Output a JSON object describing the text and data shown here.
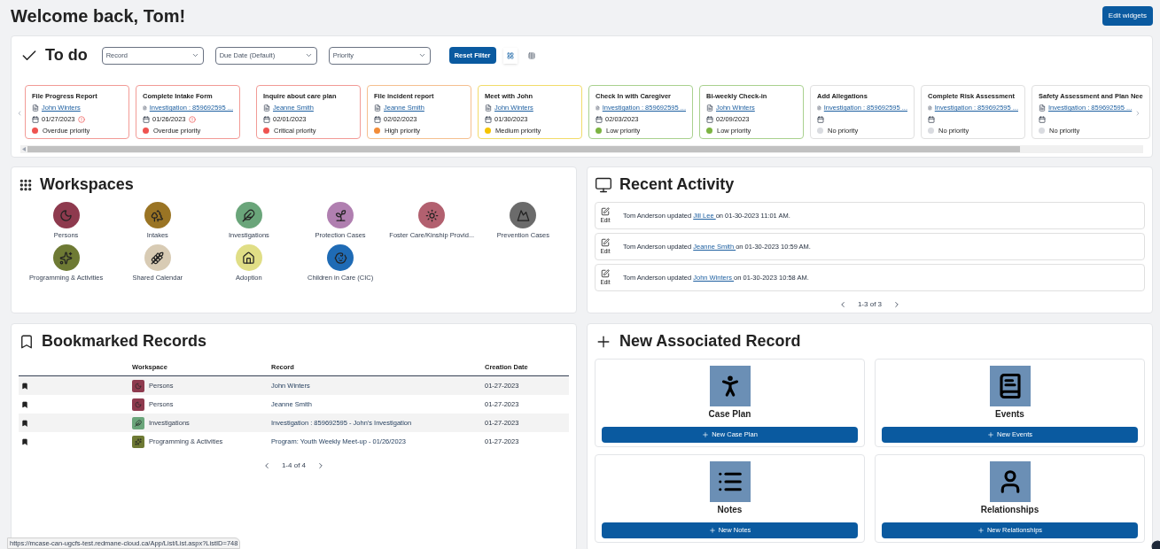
{
  "page": {
    "title": "Welcome back, Tom!",
    "edit_button": "Edit widgets"
  },
  "todo": {
    "title": "To do",
    "filters": [
      {
        "value": "Record"
      },
      {
        "value": "Due Date (Default)"
      },
      {
        "value": "Priority"
      }
    ],
    "reset_button": "Reset Filter",
    "views": [
      {
        "kind": "grid",
        "selected": true
      },
      {
        "kind": "list",
        "selected": false
      }
    ],
    "items": [
      {
        "title": "File Progress Report",
        "record": "John Winters",
        "date": "01/27/2023",
        "overdue": true,
        "kind": "overdue",
        "priority_label": "Overdue priority"
      },
      {
        "title": "Complete Intake Form",
        "record": "Investigation : 859692595 ...",
        "date": "01/26/2023",
        "overdue": true,
        "kind": "overdue",
        "priority_label": "Overdue priority"
      },
      {
        "title": "Inquire about care plan",
        "record": "Jeanne Smith",
        "date": "02/01/2023",
        "overdue": false,
        "kind": "critical",
        "priority_label": "Critical priority"
      },
      {
        "title": "File incident report",
        "record": "Jeanne Smith",
        "date": "02/02/2023",
        "overdue": false,
        "kind": "high",
        "priority_label": "High priority"
      },
      {
        "title": "Meet with John",
        "record": "John Winters",
        "date": "01/30/2023",
        "overdue": false,
        "kind": "medium",
        "priority_label": "Medium priority"
      },
      {
        "title": "Check In with Caregiver",
        "record": "Investigation : 859692595 ...",
        "date": "02/03/2023",
        "overdue": false,
        "kind": "low",
        "priority_label": "Low priority"
      },
      {
        "title": "Bi-weekly Check-in",
        "record": "John Winters",
        "date": "02/09/2023",
        "overdue": false,
        "kind": "low",
        "priority_label": "Low priority"
      },
      {
        "title": "Add Allegations",
        "record": "Investigation : 859692595 ...",
        "overdue": false,
        "kind": "none",
        "priority_label": "No priority"
      },
      {
        "title": "Complete Risk Assessment",
        "record": "Investigation : 859692595 ...",
        "overdue": false,
        "kind": "none",
        "priority_label": "No priority"
      },
      {
        "title": "Safety Assessment and Plan Nee",
        "record": "Investigation : 859692595 ...",
        "overdue": false,
        "kind": "none",
        "priority_label": "No priority"
      }
    ]
  },
  "workspaces": {
    "title": "Workspaces",
    "items": [
      {
        "label": "Persons",
        "kind": "moon",
        "color": "#8e3a4e"
      },
      {
        "label": "Intakes",
        "kind": "trees",
        "color": "#9a7424"
      },
      {
        "label": "Investigations",
        "kind": "feather",
        "color": "#6aa57a"
      },
      {
        "label": "Protection Cases",
        "kind": "sprout",
        "color": "#b07fb0"
      },
      {
        "label": "Foster Care/Kinship Provid...",
        "kind": "sun",
        "color": "#b2606f"
      },
      {
        "label": "Prevention Cases",
        "kind": "mountain",
        "color": "#6b6b6b"
      },
      {
        "label": "Programming & Activities",
        "kind": "stars",
        "color": "#6e7a34"
      },
      {
        "label": "Shared Calendar",
        "kind": "wheat",
        "color": "#d8cbb4"
      },
      {
        "label": "Adoption",
        "kind": "home",
        "color": "#e0de86"
      },
      {
        "label": "Children in Care (CIC)",
        "kind": "child",
        "color": "#1f6bb5"
      }
    ]
  },
  "recent_activity": {
    "title": "Recent Activity",
    "items": [
      {
        "action": "Edit",
        "before": "Tom Anderson updated ",
        "link": "Jill Lee ",
        "after": " on 01-30-2023 11:01 AM."
      },
      {
        "action": "Edit",
        "before": "Tom Anderson updated ",
        "link": "Jeanne Smith ",
        "after": " on 01-30-2023 10:59 AM."
      },
      {
        "action": "Edit",
        "before": "Tom Anderson updated ",
        "link": "John Winters ",
        "after": " on 01-30-2023 10:58 AM."
      }
    ],
    "pager": "1-3 of 3"
  },
  "bookmarks": {
    "title": "Bookmarked Records",
    "columns": [
      "Workspace",
      "Record",
      "Creation Date"
    ],
    "rows": [
      {
        "workspace": "Persons",
        "kind": "moon",
        "color": "#8e3a4e",
        "record": "John Winters",
        "date": "01-27-2023"
      },
      {
        "workspace": "Persons",
        "kind": "moon",
        "color": "#8e3a4e",
        "record": "Jeanne Smith",
        "date": "01-27-2023"
      },
      {
        "workspace": "Investigations",
        "kind": "feather",
        "color": "#6aa57a",
        "record": "Investigation : 859692595 - John's Investigation",
        "date": "01-27-2023"
      },
      {
        "workspace": "Programming & Activities",
        "kind": "stars",
        "color": "#6e7a34",
        "record": "Program: Youth Weekly Meet-up - 01/26/2023",
        "date": "01-27-2023"
      }
    ],
    "pager": "1-4 of 4"
  },
  "new_record": {
    "title": "New Associated Record",
    "items": [
      {
        "kind": "person",
        "label": "Case Plan",
        "button": "New Case Plan"
      },
      {
        "kind": "book",
        "label": "Events",
        "button": "New Events"
      },
      {
        "kind": "list",
        "label": "Notes",
        "button": "New Notes"
      },
      {
        "kind": "user",
        "label": "Relationships",
        "button": "New Relationships"
      }
    ]
  },
  "status_bar": {
    "url": "https://mcase-can-ugcfs-test.redmane-cloud.ca/App/List/List.aspx?ListID=748"
  }
}
